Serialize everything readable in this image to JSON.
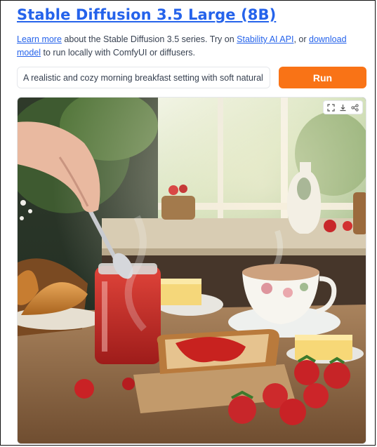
{
  "header": {
    "title": "Stable Diffusion 3.5 Large (8B)"
  },
  "description": {
    "link_learn_more": "Learn more",
    "text_1": " about the Stable Diffusion 3.5 series. Try on ",
    "link_api": "Stability AI API",
    "text_2": ", or ",
    "link_download": "download model",
    "text_3": " to run locally with ComfyUI or diffusers."
  },
  "prompt": {
    "value": "A realistic and cozy morning breakfast setting with soft natural light pouring in"
  },
  "run_button": {
    "label": "Run"
  },
  "image_toolbar": {
    "icons": [
      "fullscreen-icon",
      "download-icon",
      "share-icon"
    ]
  },
  "colors": {
    "link": "#2563eb",
    "run_button": "#f97316"
  }
}
